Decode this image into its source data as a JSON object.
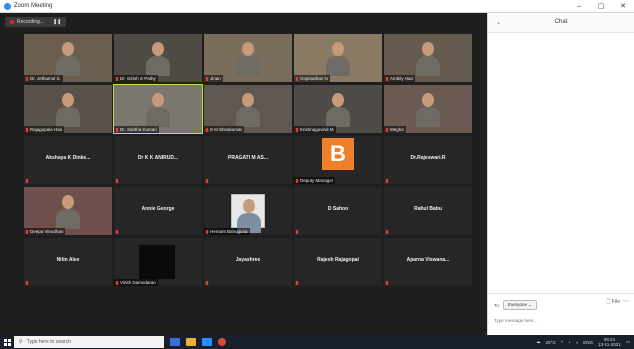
{
  "window": {
    "title": "Zoom Meeting",
    "controls": [
      "–",
      "▢",
      "✕"
    ]
  },
  "recording": {
    "label": "Recording..."
  },
  "participants": [
    {
      "name": "Dr. Jethumol S.",
      "kind": "video"
    },
    {
      "name": "Dr. Girish S Pathy",
      "kind": "video"
    },
    {
      "name": "Jinan",
      "kind": "video"
    },
    {
      "name": "Gopinathan N",
      "kind": "video"
    },
    {
      "name": "Ambily Hari",
      "kind": "video"
    },
    {
      "name": "Rajagopala Hari",
      "kind": "video"
    },
    {
      "name": "Dr. Saritha Kumari",
      "kind": "video",
      "active": true
    },
    {
      "name": "S Krishnakumar",
      "kind": "video"
    },
    {
      "name": "Krishnagovind M",
      "kind": "video"
    },
    {
      "name": "Megha",
      "kind": "video"
    },
    {
      "name": "Akshaya K Dinke...",
      "kind": "name"
    },
    {
      "name": "Dr K K ANIRUD...",
      "kind": "name"
    },
    {
      "name": "PRAGATI M AS...",
      "kind": "name"
    },
    {
      "name": "Deputy Manager",
      "kind": "logo",
      "logo": "B"
    },
    {
      "name": "Dr.Rajeswari.R",
      "kind": "name"
    },
    {
      "name": "Deepa Vinodhan",
      "kind": "video"
    },
    {
      "name": "Annie George",
      "kind": "name"
    },
    {
      "name": "Hemant Bahuguna",
      "kind": "photo"
    },
    {
      "name": "D Sahoo",
      "kind": "name"
    },
    {
      "name": "Rahul Babu",
      "kind": "name"
    },
    {
      "name": "Nitin Alex",
      "kind": "name"
    },
    {
      "name": "Vinith Damodaran",
      "kind": "dark"
    },
    {
      "name": "Jayashree",
      "kind": "name"
    },
    {
      "name": "Rajesh Rajagopal",
      "kind": "name"
    },
    {
      "name": "Aparna Viswana...",
      "kind": "name"
    }
  ],
  "chat": {
    "title": "Chat",
    "to_label": "To:",
    "to_value": "Everyone",
    "file_label": "File",
    "input_placeholder": "Type message here..."
  },
  "taskbar": {
    "search_placeholder": "Type here to search",
    "tray_temp": "29°C",
    "tray_lang": "ENG",
    "time": "09:24",
    "date": "13-11-2021"
  },
  "colors": {
    "accent": "#2d8cff",
    "active_speaker": "#c6d94a",
    "logo_bg": "#ef7f2b",
    "mute": "#e03a3a"
  }
}
